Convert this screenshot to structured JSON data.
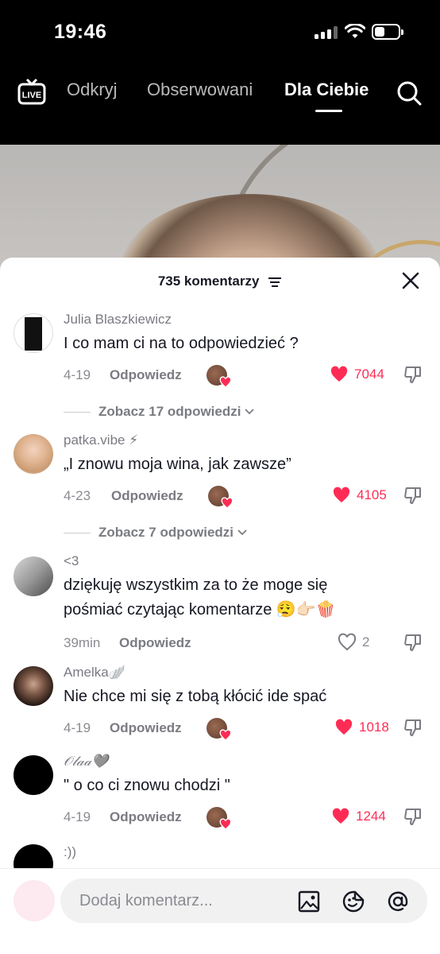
{
  "status_bar": {
    "time": "19:46"
  },
  "top_nav": {
    "live_label": "LIVE",
    "tabs": [
      {
        "label": "Odkryj",
        "active": false
      },
      {
        "label": "Obserwowani",
        "active": false
      },
      {
        "label": "Dla Ciebie",
        "active": true
      }
    ]
  },
  "comments_panel": {
    "count_label": "735 komentarzy",
    "comments": [
      {
        "username": "Julia Blaszkiewicz",
        "text": "I co mam ci na to odpowiedzieć ?",
        "date": "4-19",
        "reply_label": "Odpowiedz",
        "likes": "7044",
        "liked": true,
        "creator_liked": true,
        "view_replies": "Zobacz 17 odpowiedzi"
      },
      {
        "username": "patka.vibe ⚡",
        "text": "„I znowu moja wina, jak zawsze”",
        "date": "4-23",
        "reply_label": "Odpowiedz",
        "likes": "4105",
        "liked": true,
        "creator_liked": true,
        "view_replies": "Zobacz 7 odpowiedzi"
      },
      {
        "username": "<3",
        "text": "dziękuję wszystkim za to że moge się pośmiać czytając komentarze 😮‍💨👉🏻🍿",
        "date": "39min",
        "reply_label": "Odpowiedz",
        "likes": "2",
        "liked": false,
        "creator_liked": false
      },
      {
        "username": "Amelka🪽",
        "text": "Nie chce mi się z tobą kłócić ide spać",
        "date": "4-19",
        "reply_label": "Odpowiedz",
        "likes": "1018",
        "liked": true,
        "creator_liked": true
      },
      {
        "username": "𝒪𝓁𝒶𝒶🩶",
        "text": "\" o co ci znowu chodzi \"",
        "date": "4-19",
        "reply_label": "Odpowiedz",
        "likes": "1244",
        "liked": true,
        "creator_liked": true
      },
      {
        "username": ":))",
        "text": ""
      }
    ]
  },
  "composer": {
    "placeholder": "Dodaj komentarz..."
  },
  "colors": {
    "like_red": "#fe2c55",
    "text_dark": "#161823",
    "text_gray": "#7a7b82"
  },
  "icons": [
    "live-icon",
    "search-icon",
    "filter-icon",
    "close-icon",
    "heart-icon",
    "dislike-icon",
    "image-icon",
    "sticker-icon",
    "mention-icon"
  ]
}
